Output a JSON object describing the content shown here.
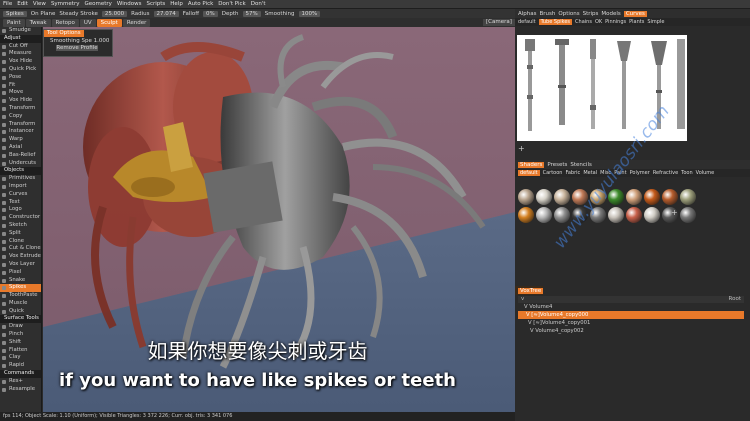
{
  "menu": [
    "File",
    "Edit",
    "View",
    "Symmetry",
    "Geometry",
    "Windows",
    "Scripts",
    "Help",
    "Auto Pick",
    "Don't Pick",
    "Don't"
  ],
  "toolbar": {
    "spikes": "Spikes",
    "on_plane": "On Plane",
    "steady_stroke": "Steady Stroke",
    "steady_value": "25.000",
    "radius": "Radius",
    "radius_value": "27.074",
    "falloff": "Falloff",
    "falloff_value": "0%",
    "depth": "Depth",
    "depth_value": "57%",
    "smoothing": "Smoothing",
    "smoothing_value": "100%"
  },
  "mode_tabs": [
    "Paint",
    "Tweak",
    "Retopo",
    "UV",
    "Sculpt",
    "Render"
  ],
  "active_mode": "Sculpt",
  "camera_label": "[Camera]",
  "left_tools": [
    {
      "label": "Smudge",
      "type": "tool"
    },
    {
      "label": "Adjust",
      "type": "hdr"
    },
    {
      "label": "Cut Off",
      "type": "tool"
    },
    {
      "label": "Measure",
      "type": "tool"
    },
    {
      "label": "Vox Hide",
      "type": "tool"
    },
    {
      "label": "Quick Pick",
      "type": "tool"
    },
    {
      "label": "Pose",
      "type": "tool"
    },
    {
      "label": "Fit",
      "type": "tool"
    },
    {
      "label": "Move",
      "type": "tool"
    },
    {
      "label": "Vox Hide",
      "type": "tool"
    },
    {
      "label": "Transform",
      "type": "tool"
    },
    {
      "label": "Copy",
      "type": "tool"
    },
    {
      "label": "Transform",
      "type": "tool"
    },
    {
      "label": "Instancer",
      "type": "tool"
    },
    {
      "label": "Warp",
      "type": "tool"
    },
    {
      "label": "Axial",
      "type": "tool"
    },
    {
      "label": "Bas-Relief",
      "type": "tool"
    },
    {
      "label": "Undercuts",
      "type": "tool"
    },
    {
      "label": "Objects",
      "type": "hdr"
    },
    {
      "label": "Primitives",
      "type": "tool"
    },
    {
      "label": "Import",
      "type": "tool"
    },
    {
      "label": "Curves",
      "type": "tool"
    },
    {
      "label": "Text",
      "type": "tool"
    },
    {
      "label": "Logo",
      "type": "tool"
    },
    {
      "label": "Constructor",
      "type": "tool"
    },
    {
      "label": "Sketch",
      "type": "tool"
    },
    {
      "label": "Split",
      "type": "tool"
    },
    {
      "label": "Clone",
      "type": "tool"
    },
    {
      "label": "Cut & Clone",
      "type": "tool"
    },
    {
      "label": "Vox Extrude",
      "type": "tool"
    },
    {
      "label": "Vox Layer",
      "type": "tool"
    },
    {
      "label": "Pixel",
      "type": "tool"
    },
    {
      "label": "Snake",
      "type": "tool"
    },
    {
      "label": "Spikes",
      "type": "sel"
    },
    {
      "label": "ToothPaste",
      "type": "tool"
    },
    {
      "label": "Muscle",
      "type": "tool"
    },
    {
      "label": "Quick",
      "type": "tool"
    },
    {
      "label": "Surface Tools",
      "type": "hdr"
    },
    {
      "label": "Draw",
      "type": "tool"
    },
    {
      "label": "Pinch",
      "type": "tool"
    },
    {
      "label": "Shift",
      "type": "tool"
    },
    {
      "label": "Flatten",
      "type": "tool"
    },
    {
      "label": "Clay",
      "type": "tool"
    },
    {
      "label": "Rapid",
      "type": "tool"
    },
    {
      "label": "Commands",
      "type": "hdr"
    },
    {
      "label": "Res+",
      "type": "tool"
    },
    {
      "label": "Resample",
      "type": "tool"
    }
  ],
  "tool_options": {
    "title": "Tool Options",
    "smoothing_label": "Smoothing Spe",
    "smoothing_value": "1.000",
    "remove_label": "Remove Profile"
  },
  "status_text": "fps 114;  Object Scale: 1.10 (Uniform);  Visible Triangles: 3 372 226;  Curr. obj. tris: 3 341 076",
  "right_tabs": [
    "Alphas",
    "Brush",
    "Options",
    "Strips",
    "Models",
    "Curves"
  ],
  "right_active": "Curves",
  "curve_subtabs": [
    "default",
    "Tube Spikes",
    "Chains",
    "OK",
    "Pinnings",
    "Plants",
    "Simple"
  ],
  "curve_subtab_active": "Tube Spikes",
  "shader_tabs": [
    "Shaders",
    "Presets",
    "Stencils"
  ],
  "shader_active": "Shaders",
  "shader_subtabs": [
    "default",
    "Cartoon",
    "Fabric",
    "Metal",
    "Misc",
    "Paint",
    "Polymer",
    "Refractive",
    "Toon",
    "Volume"
  ],
  "shader_sub_active": "default",
  "material_colors": [
    "#b9a58f",
    "#d6d2c8",
    "#c9b49c",
    "#c27b58",
    "#c9a36b",
    "#3c8a2a",
    "#d0a07a",
    "#c45a1a",
    "#b55c2c",
    "#9ea07c",
    "#d48020",
    "#b7b7b7",
    "#8f8f8f",
    "#3a3a3a",
    "#7a7a7a",
    "#c8c2ba",
    "#c8604a",
    "#d0ccc4",
    "#5a5a5a",
    "#777"
  ],
  "voxtree_tab": "VoxTree",
  "tree_header_left": "v",
  "tree_header_right": "Root",
  "tree_rows": [
    {
      "label": "V  Volume4",
      "sel": false
    },
    {
      "label": "V  [≈]Volume4_copy000",
      "sel": true
    },
    {
      "label": "V  [≈]Volume4_copy001",
      "sel": false
    },
    {
      "label": "V  Volume4_copy002",
      "sel": false
    }
  ],
  "subtitle_cn": "如果你想要像尖刺或牙齿",
  "subtitle_en": "if you want to have like spikes or teeth",
  "watermark": "www.yuyulaosri.com"
}
